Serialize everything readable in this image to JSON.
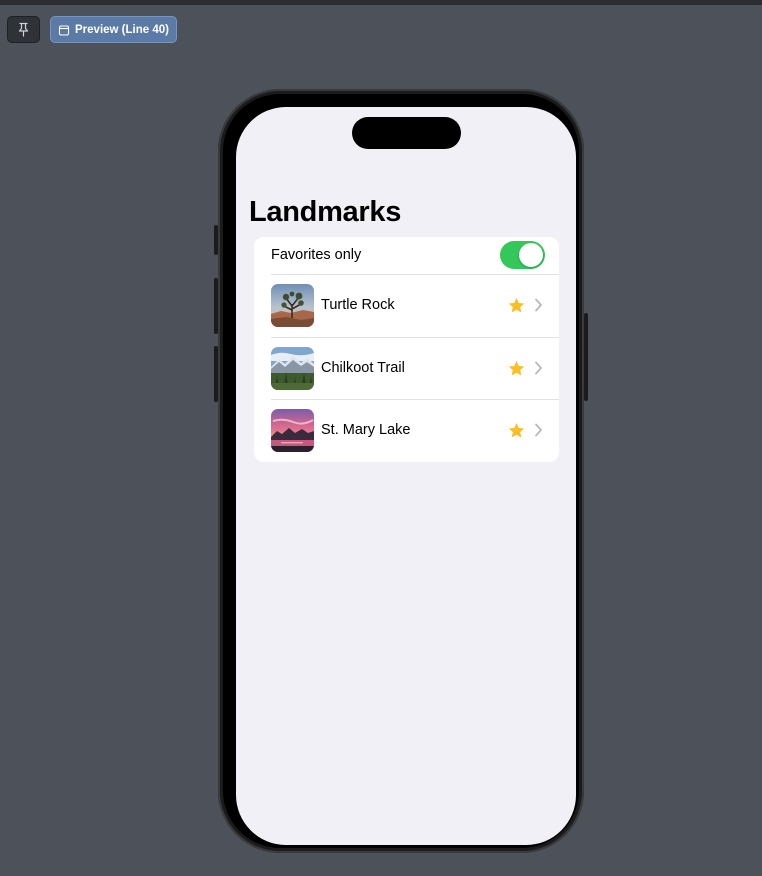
{
  "toolbar": {
    "pin_icon": "pin-icon",
    "preview_icon": "preview-device-icon",
    "preview_label": "Preview (Line 40)"
  },
  "screen": {
    "title": "Landmarks",
    "favorites_toggle": {
      "label": "Favorites only",
      "is_on": true,
      "on_color": "#34c759"
    },
    "landmarks": [
      {
        "name": "Turtle Rock",
        "is_favorite": true,
        "thumbnail": "turtle-rock-photo"
      },
      {
        "name": "Chilkoot Trail",
        "is_favorite": true,
        "thumbnail": "chilkoot-trail-photo"
      },
      {
        "name": "St. Mary Lake",
        "is_favorite": true,
        "thumbnail": "st-mary-lake-photo"
      }
    ],
    "star_color": "#fbbf24"
  }
}
